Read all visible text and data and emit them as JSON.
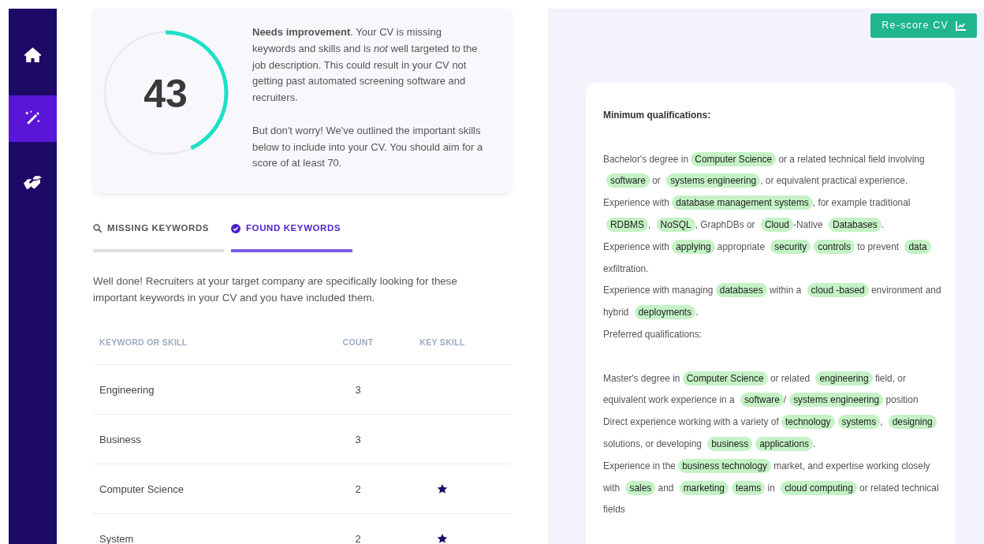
{
  "sidebar": {
    "items": [
      {
        "selected": false
      },
      {
        "selected": true
      },
      {
        "selected": false
      }
    ]
  },
  "score": {
    "value": "43",
    "level": 0.43,
    "paragraphs": [
      "**Needs improvement**. Your CV is missing keywords and skills and is *not* well targeted to the job description. This could result in your CV not getting past automated screening software and recruiters.",
      "But don't worry! We've outlined the important skills below to include into your CV. You should aim for a score of at least 70."
    ]
  },
  "tabs": [
    {
      "label": "MISSING KEYWORDS",
      "selected": false
    },
    {
      "label": "FOUND KEYWORDS",
      "selected": true
    }
  ],
  "intro": "Well done! Recruiters at your target company are specifically looking for these important keywords in your CV and you have included them.",
  "table": {
    "columns": [
      "KEYWORD OR SKILL",
      "COUNT",
      "KEY SKILL"
    ],
    "rows": [
      {
        "keyword": "Engineering",
        "count": "3",
        "key_skill": false
      },
      {
        "keyword": "Business",
        "count": "3",
        "key_skill": false
      },
      {
        "keyword": "Computer Science",
        "count": "2",
        "key_skill": true
      },
      {
        "keyword": "System",
        "count": "2",
        "key_skill": true
      }
    ]
  },
  "rescore_button": "Re-score CV",
  "job_description": {
    "heading": "Minimum qualifications:",
    "minimum": [
      [
        {
          "kind": "text",
          "text": "Bachelor's degree in "
        },
        {
          "kind": "keyword",
          "text": "Computer Science"
        },
        {
          "kind": "text",
          "text": " or a related technical field involving "
        },
        {
          "kind": "keyword",
          "text": "software"
        },
        {
          "kind": "text",
          "text": " or "
        },
        {
          "kind": "keyword",
          "text": "systems engineering"
        },
        {
          "kind": "text",
          "text": ", or equivalent practical experience."
        }
      ],
      [
        {
          "kind": "text",
          "text": "Experience with "
        },
        {
          "kind": "keyword",
          "text": "database management systems"
        },
        {
          "kind": "text",
          "text": ", for example traditional "
        },
        {
          "kind": "keyword",
          "text": "RDBMS"
        },
        {
          "kind": "text",
          "text": ", "
        },
        {
          "kind": "keyword",
          "text": "NoSQL"
        },
        {
          "kind": "text",
          "text": ", GraphDBs or "
        },
        {
          "kind": "keyword",
          "text": "Cloud"
        },
        {
          "kind": "text",
          "text": "-Native "
        },
        {
          "kind": "keyword",
          "text": "Databases"
        },
        {
          "kind": "text",
          "text": "."
        }
      ],
      [
        {
          "kind": "text",
          "text": "Experience with "
        },
        {
          "kind": "keyword",
          "text": "applying"
        },
        {
          "kind": "text",
          "text": " appropriate "
        },
        {
          "kind": "keyword",
          "text": "security"
        },
        {
          "kind": "keyword",
          "text": "controls"
        },
        {
          "kind": "text",
          "text": " to prevent "
        },
        {
          "kind": "keyword",
          "text": "data"
        },
        {
          "kind": "text",
          "text": " exfiltration."
        }
      ],
      [
        {
          "kind": "text",
          "text": "Experience with managing "
        },
        {
          "kind": "keyword",
          "text": "databases"
        },
        {
          "kind": "text",
          "text": " within a "
        },
        {
          "kind": "keyword",
          "text": "cloud -based"
        },
        {
          "kind": "text",
          "text": " environment and hybrid "
        },
        {
          "kind": "keyword",
          "text": "deployments"
        },
        {
          "kind": "text",
          "text": "."
        }
      ]
    ],
    "preferred_heading": "Preferred qualifications:",
    "preferred": [
      [
        {
          "kind": "text",
          "text": "Master's degree in "
        },
        {
          "kind": "keyword",
          "text": "Computer Science"
        },
        {
          "kind": "text",
          "text": " or related "
        },
        {
          "kind": "keyword",
          "text": "engineering"
        },
        {
          "kind": "text",
          "text": " field, or equivalent work experience in a "
        },
        {
          "kind": "keyword",
          "text": "software"
        },
        {
          "kind": "text",
          "text": "/"
        },
        {
          "kind": "keyword",
          "text": "systems engineering"
        },
        {
          "kind": "text",
          "text": " position"
        }
      ],
      [
        {
          "kind": "text",
          "text": "Direct experience working with a variety of "
        },
        {
          "kind": "keyword",
          "text": "technology"
        },
        {
          "kind": "keyword",
          "text": "systems"
        },
        {
          "kind": "text",
          "text": ", "
        },
        {
          "kind": "keyword",
          "text": "designing"
        },
        {
          "kind": "text",
          "text": " solutions, or developing "
        },
        {
          "kind": "keyword",
          "text": "business"
        },
        {
          "kind": "keyword",
          "text": "applications"
        },
        {
          "kind": "text",
          "text": "."
        }
      ],
      [
        {
          "kind": "text",
          "text": "Experience in the "
        },
        {
          "kind": "keyword",
          "text": "business technology"
        },
        {
          "kind": "text",
          "text": " market, and expertise working closely with "
        },
        {
          "kind": "keyword",
          "text": "sales"
        },
        {
          "kind": "text",
          "text": " and "
        },
        {
          "kind": "keyword",
          "text": "marketing"
        },
        {
          "kind": "keyword",
          "text": "teams"
        },
        {
          "kind": "text",
          "text": " in "
        },
        {
          "kind": "keyword",
          "text": "cloud computing"
        },
        {
          "kind": "text",
          "text": " or related technical fields"
        }
      ]
    ]
  }
}
